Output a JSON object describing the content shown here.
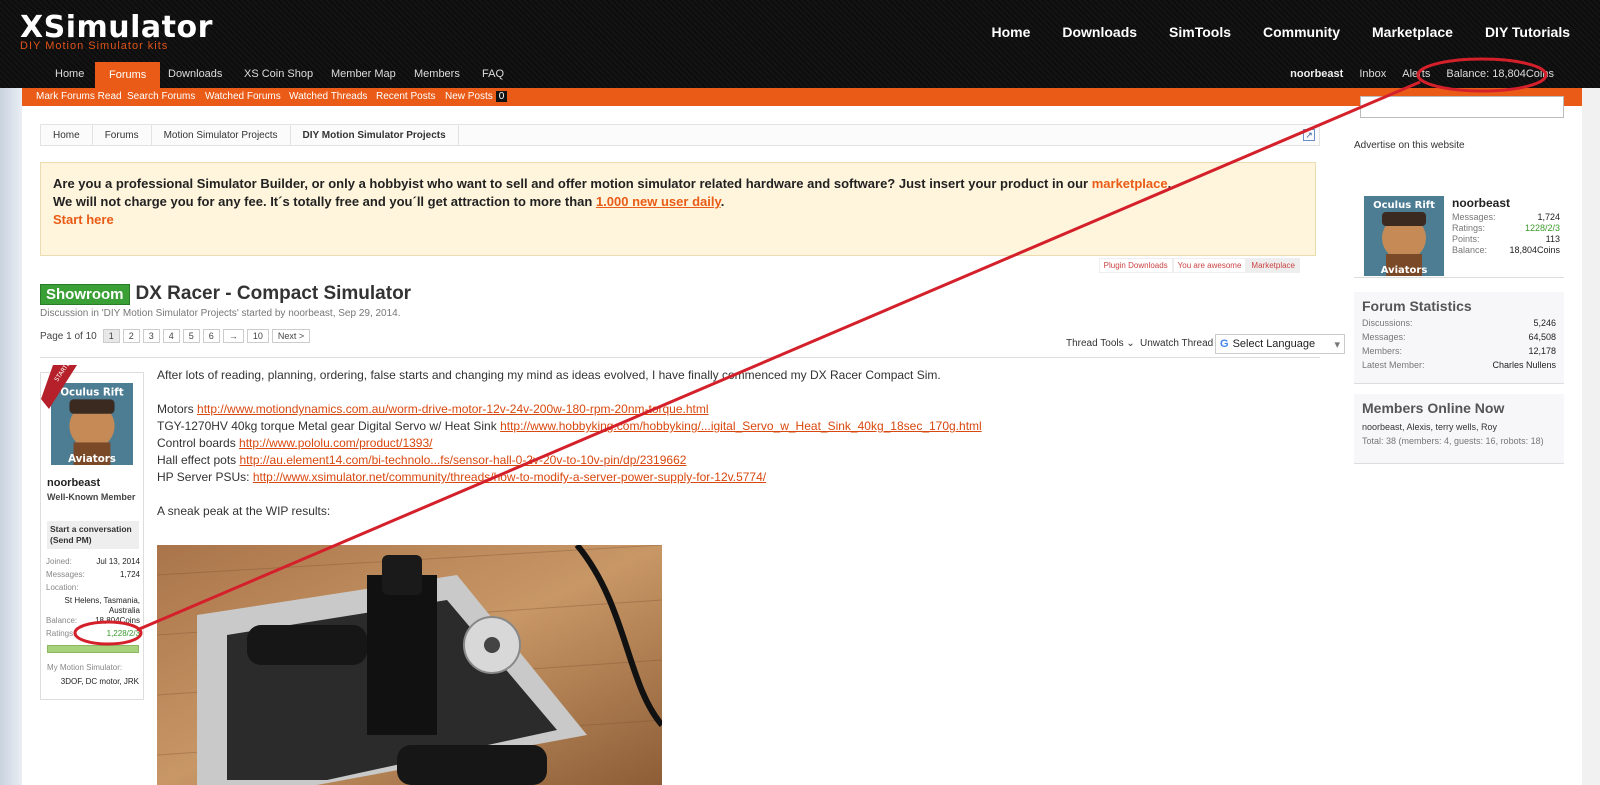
{
  "header": {
    "logo": "XSimulator",
    "logo_sub": "DIY Motion Simulator kits",
    "main_nav": [
      "Home",
      "Downloads",
      "SimTools",
      "Community",
      "Marketplace",
      "DIY Tutorials"
    ],
    "sub_nav": [
      "Home",
      "Forums",
      "Downloads",
      "XS Coin Shop",
      "Member Map",
      "Members",
      "FAQ"
    ],
    "active_sub": "Forums",
    "user": {
      "name": "noorbeast",
      "inbox": "Inbox",
      "alerts": "Alerts",
      "balance": "Balance: 18,804Coins"
    },
    "forum_links": [
      "Mark Forums Read",
      "Search Forums",
      "Watched Forums",
      "Watched Threads",
      "Recent Posts",
      "New Posts"
    ],
    "new_posts_count": "0"
  },
  "breadcrumb": [
    "Home",
    "Forums",
    "Motion Simulator Projects",
    "DIY Motion Simulator Projects"
  ],
  "notice": {
    "line1_a": "Are you a professional Simulator Builder, or only a hobbyist who want to sell and offer motion simulator related hardware and software? Just insert your product in our ",
    "line1_link": "marketplace",
    "line1_end": ".",
    "line2_a": "We will not charge you for any fee. It´s totally free and you´ll get attraction to more than ",
    "line2_link": "1.000 new user daily",
    "line2_end": ".",
    "line3_link": "Start here"
  },
  "ad_links": [
    "Plugin Downloads",
    "You are awesome",
    "Marketplace"
  ],
  "thread": {
    "prefix": "Showroom",
    "title": "DX Racer - Compact Simulator",
    "meta_a": "Discussion in '",
    "meta_forum": "DIY Motion Simulator Projects",
    "meta_b": "' started by ",
    "meta_user": "noorbeast",
    "meta_c": ", Sep 29, 2014."
  },
  "pager": {
    "label": "Page 1 of 10",
    "pages": [
      "1",
      "2",
      "3",
      "4",
      "5",
      "6",
      "→",
      "10"
    ],
    "next": "Next >"
  },
  "thread_tools": "Thread Tools",
  "unwatch": "Unwatch Thread",
  "language": "Select Language",
  "user_card": {
    "ribbon": "STARTER",
    "name": "noorbeast",
    "rank": "Well-Known Member",
    "pm": "Start a conversation (Send PM)",
    "joined_label": "Joined:",
    "joined": "Jul 13, 2014",
    "messages_label": "Messages:",
    "messages": "1,724",
    "location_label": "Location:",
    "location": "St Helens, Tasmania, Australia",
    "balance_label": "Balance:",
    "balance": "18,804Coins",
    "ratings_label": "Ratings:",
    "ratings": "1,228/2/3",
    "sim_label": "My Motion Simulator:",
    "sim": "3DOF, DC motor, JRK"
  },
  "post": {
    "intro": "After lots of reading, planning, ordering, false starts and changing my mind as ideas evolved, I have finally commenced my DX Racer Compact Sim.",
    "lines": [
      {
        "label": "Motors ",
        "link": "http://www.motiondynamics.com.au/worm-drive-motor-12v-24v-200w-180-rpm-20nm-torque.html"
      },
      {
        "label": "TGY-1270HV 40kg torque Metal gear Digital Servo w/ Heat Sink ",
        "link": "http://www.hobbyking.com/hobbyking/...igital_Servo_w_Heat_Sink_40kg_18sec_170g.html"
      },
      {
        "label": "Control boards ",
        "link": "http://www.pololu.com/product/1393/"
      },
      {
        "label": "Hall effect pots ",
        "link": "http://au.element14.com/bi-technolo...fs/sensor-hall-0-2v-20v-to-10v-pin/dp/2319662"
      },
      {
        "label": "HP Server PSUs: ",
        "link": "http://www.xsimulator.net/community/threads/how-to-modify-a-server-power-supply-for-12v.5774/"
      }
    ],
    "outro": "A sneak peak at the WIP results:"
  },
  "sidebar": {
    "advertise": "Advertise on this website",
    "user": {
      "name": "noorbeast",
      "rows": [
        {
          "k": "Messages:",
          "v": "1,724"
        },
        {
          "k": "Ratings:",
          "v": "1228/2/3"
        },
        {
          "k": "Points:",
          "v": "113"
        },
        {
          "k": "Balance:",
          "v": "18,804Coins"
        }
      ]
    },
    "stats": {
      "title": "Forum Statistics",
      "rows": [
        {
          "k": "Discussions:",
          "v": "5,246"
        },
        {
          "k": "Messages:",
          "v": "64,508"
        },
        {
          "k": "Members:",
          "v": "12,178"
        },
        {
          "k": "Latest Member:",
          "v": "Charles Nullens"
        }
      ]
    },
    "online": {
      "title": "Members Online Now",
      "names": "noorbeast, Alexis, terry wells, Roy",
      "total": "Total: 38 (members: 4, guests: 16, robots: 18)"
    }
  },
  "colors": {
    "brand_orange": "#e95b16",
    "prefix_green": "#3aa035",
    "annotation_red": "#d4202a"
  }
}
